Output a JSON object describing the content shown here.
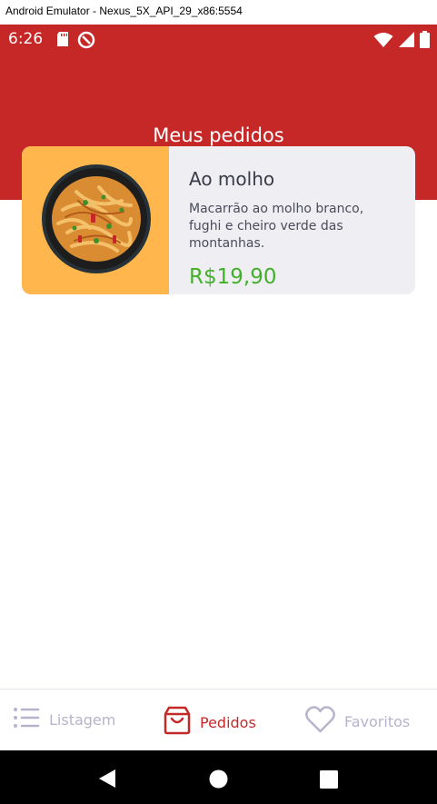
{
  "window": {
    "title": "Android Emulator - Nexus_5X_API_29_x86:5554"
  },
  "status_bar": {
    "time": "6:26",
    "left_icons": [
      "sd-card-icon",
      "data-saver-icon"
    ],
    "right_icons": [
      "wifi-icon",
      "cell-signal-icon",
      "battery-icon"
    ]
  },
  "header": {
    "title": "Meus pedidos"
  },
  "orders": [
    {
      "name": "Ao molho",
      "description": "Macarrão ao molho branco, fughi e cheiro verde das montanhas.",
      "price": "R$19,90",
      "image": "pasta-dish-image"
    }
  ],
  "bottom_nav": {
    "items": [
      {
        "label": "Listagem",
        "icon": "list-icon",
        "active": false
      },
      {
        "label": "Pedidos",
        "icon": "shopping-bag-icon",
        "active": true
      },
      {
        "label": "Favoritos",
        "icon": "heart-icon",
        "active": false
      }
    ]
  },
  "colors": {
    "primary": "#c62828",
    "price": "#43b02a",
    "card_background": "#eeeef3",
    "image_background": "#ffb74d",
    "inactive_nav": "#b7b3cc"
  }
}
